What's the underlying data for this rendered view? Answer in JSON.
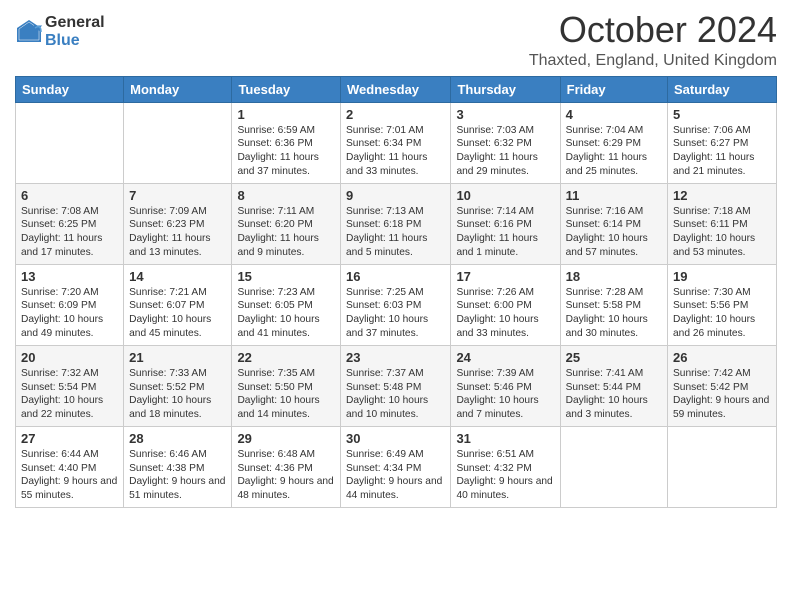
{
  "header": {
    "logo_general": "General",
    "logo_blue": "Blue",
    "month_title": "October 2024",
    "location": "Thaxted, England, United Kingdom"
  },
  "days_of_week": [
    "Sunday",
    "Monday",
    "Tuesday",
    "Wednesday",
    "Thursday",
    "Friday",
    "Saturday"
  ],
  "weeks": [
    [
      {
        "day": "",
        "content": ""
      },
      {
        "day": "",
        "content": ""
      },
      {
        "day": "1",
        "content": "Sunrise: 6:59 AM\nSunset: 6:36 PM\nDaylight: 11 hours and 37 minutes."
      },
      {
        "day": "2",
        "content": "Sunrise: 7:01 AM\nSunset: 6:34 PM\nDaylight: 11 hours and 33 minutes."
      },
      {
        "day": "3",
        "content": "Sunrise: 7:03 AM\nSunset: 6:32 PM\nDaylight: 11 hours and 29 minutes."
      },
      {
        "day": "4",
        "content": "Sunrise: 7:04 AM\nSunset: 6:29 PM\nDaylight: 11 hours and 25 minutes."
      },
      {
        "day": "5",
        "content": "Sunrise: 7:06 AM\nSunset: 6:27 PM\nDaylight: 11 hours and 21 minutes."
      }
    ],
    [
      {
        "day": "6",
        "content": "Sunrise: 7:08 AM\nSunset: 6:25 PM\nDaylight: 11 hours and 17 minutes."
      },
      {
        "day": "7",
        "content": "Sunrise: 7:09 AM\nSunset: 6:23 PM\nDaylight: 11 hours and 13 minutes."
      },
      {
        "day": "8",
        "content": "Sunrise: 7:11 AM\nSunset: 6:20 PM\nDaylight: 11 hours and 9 minutes."
      },
      {
        "day": "9",
        "content": "Sunrise: 7:13 AM\nSunset: 6:18 PM\nDaylight: 11 hours and 5 minutes."
      },
      {
        "day": "10",
        "content": "Sunrise: 7:14 AM\nSunset: 6:16 PM\nDaylight: 11 hours and 1 minute."
      },
      {
        "day": "11",
        "content": "Sunrise: 7:16 AM\nSunset: 6:14 PM\nDaylight: 10 hours and 57 minutes."
      },
      {
        "day": "12",
        "content": "Sunrise: 7:18 AM\nSunset: 6:11 PM\nDaylight: 10 hours and 53 minutes."
      }
    ],
    [
      {
        "day": "13",
        "content": "Sunrise: 7:20 AM\nSunset: 6:09 PM\nDaylight: 10 hours and 49 minutes."
      },
      {
        "day": "14",
        "content": "Sunrise: 7:21 AM\nSunset: 6:07 PM\nDaylight: 10 hours and 45 minutes."
      },
      {
        "day": "15",
        "content": "Sunrise: 7:23 AM\nSunset: 6:05 PM\nDaylight: 10 hours and 41 minutes."
      },
      {
        "day": "16",
        "content": "Sunrise: 7:25 AM\nSunset: 6:03 PM\nDaylight: 10 hours and 37 minutes."
      },
      {
        "day": "17",
        "content": "Sunrise: 7:26 AM\nSunset: 6:00 PM\nDaylight: 10 hours and 33 minutes."
      },
      {
        "day": "18",
        "content": "Sunrise: 7:28 AM\nSunset: 5:58 PM\nDaylight: 10 hours and 30 minutes."
      },
      {
        "day": "19",
        "content": "Sunrise: 7:30 AM\nSunset: 5:56 PM\nDaylight: 10 hours and 26 minutes."
      }
    ],
    [
      {
        "day": "20",
        "content": "Sunrise: 7:32 AM\nSunset: 5:54 PM\nDaylight: 10 hours and 22 minutes."
      },
      {
        "day": "21",
        "content": "Sunrise: 7:33 AM\nSunset: 5:52 PM\nDaylight: 10 hours and 18 minutes."
      },
      {
        "day": "22",
        "content": "Sunrise: 7:35 AM\nSunset: 5:50 PM\nDaylight: 10 hours and 14 minutes."
      },
      {
        "day": "23",
        "content": "Sunrise: 7:37 AM\nSunset: 5:48 PM\nDaylight: 10 hours and 10 minutes."
      },
      {
        "day": "24",
        "content": "Sunrise: 7:39 AM\nSunset: 5:46 PM\nDaylight: 10 hours and 7 minutes."
      },
      {
        "day": "25",
        "content": "Sunrise: 7:41 AM\nSunset: 5:44 PM\nDaylight: 10 hours and 3 minutes."
      },
      {
        "day": "26",
        "content": "Sunrise: 7:42 AM\nSunset: 5:42 PM\nDaylight: 9 hours and 59 minutes."
      }
    ],
    [
      {
        "day": "27",
        "content": "Sunrise: 6:44 AM\nSunset: 4:40 PM\nDaylight: 9 hours and 55 minutes."
      },
      {
        "day": "28",
        "content": "Sunrise: 6:46 AM\nSunset: 4:38 PM\nDaylight: 9 hours and 51 minutes."
      },
      {
        "day": "29",
        "content": "Sunrise: 6:48 AM\nSunset: 4:36 PM\nDaylight: 9 hours and 48 minutes."
      },
      {
        "day": "30",
        "content": "Sunrise: 6:49 AM\nSunset: 4:34 PM\nDaylight: 9 hours and 44 minutes."
      },
      {
        "day": "31",
        "content": "Sunrise: 6:51 AM\nSunset: 4:32 PM\nDaylight: 9 hours and 40 minutes."
      },
      {
        "day": "",
        "content": ""
      },
      {
        "day": "",
        "content": ""
      }
    ]
  ]
}
